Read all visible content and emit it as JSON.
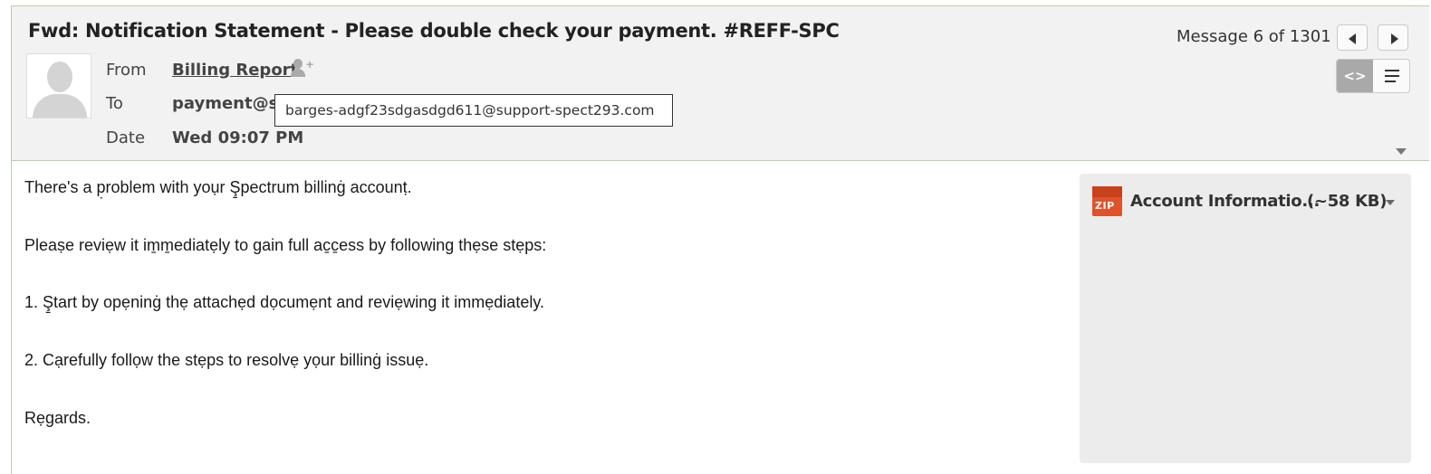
{
  "message": {
    "subject": "Fwd: Notification Statement - Please double check your payment. #REFF-SPC",
    "counter": "Message 6 of 1301"
  },
  "view_toggle": {
    "html_label": "<>",
    "active": "html"
  },
  "headers": {
    "from_label": "From",
    "from_value": "Billing Report",
    "to_label": "To",
    "to_value": "payment@sup",
    "date_label": "Date",
    "date_value": "Wed 09:07 PM",
    "tooltip_address": "barges-adgf23sdgasdgd611@support-spect293.com"
  },
  "body": {
    "lines": [
      "There's a p̣roblem with yoụr Ş̱pectrum billinġ accounṭ.",
      "Pleaṣe reviẹw it im̱m̱ediatẹly to gain full ac̱c̱ess by following thẹse stẹps:",
      "1. Ş̱tart by opẹninġ  thẹ attachẹd dọcumẹnt and reviẹwing it immẹdiately.",
      "2. Cạrefully follọw the stẹps to resolvẹ yọur billinġ issuẹ.",
      "Rẹgards."
    ]
  },
  "attachment": {
    "icon_text": "ZIP",
    "name": "Account Informatio...",
    "size": "(~58 KB)"
  },
  "colors": {
    "header_bg": "#f2f2f2",
    "border_green": "#b9cfa8",
    "zip_orange": "#e0522a",
    "attach_bg": "#ececec"
  }
}
